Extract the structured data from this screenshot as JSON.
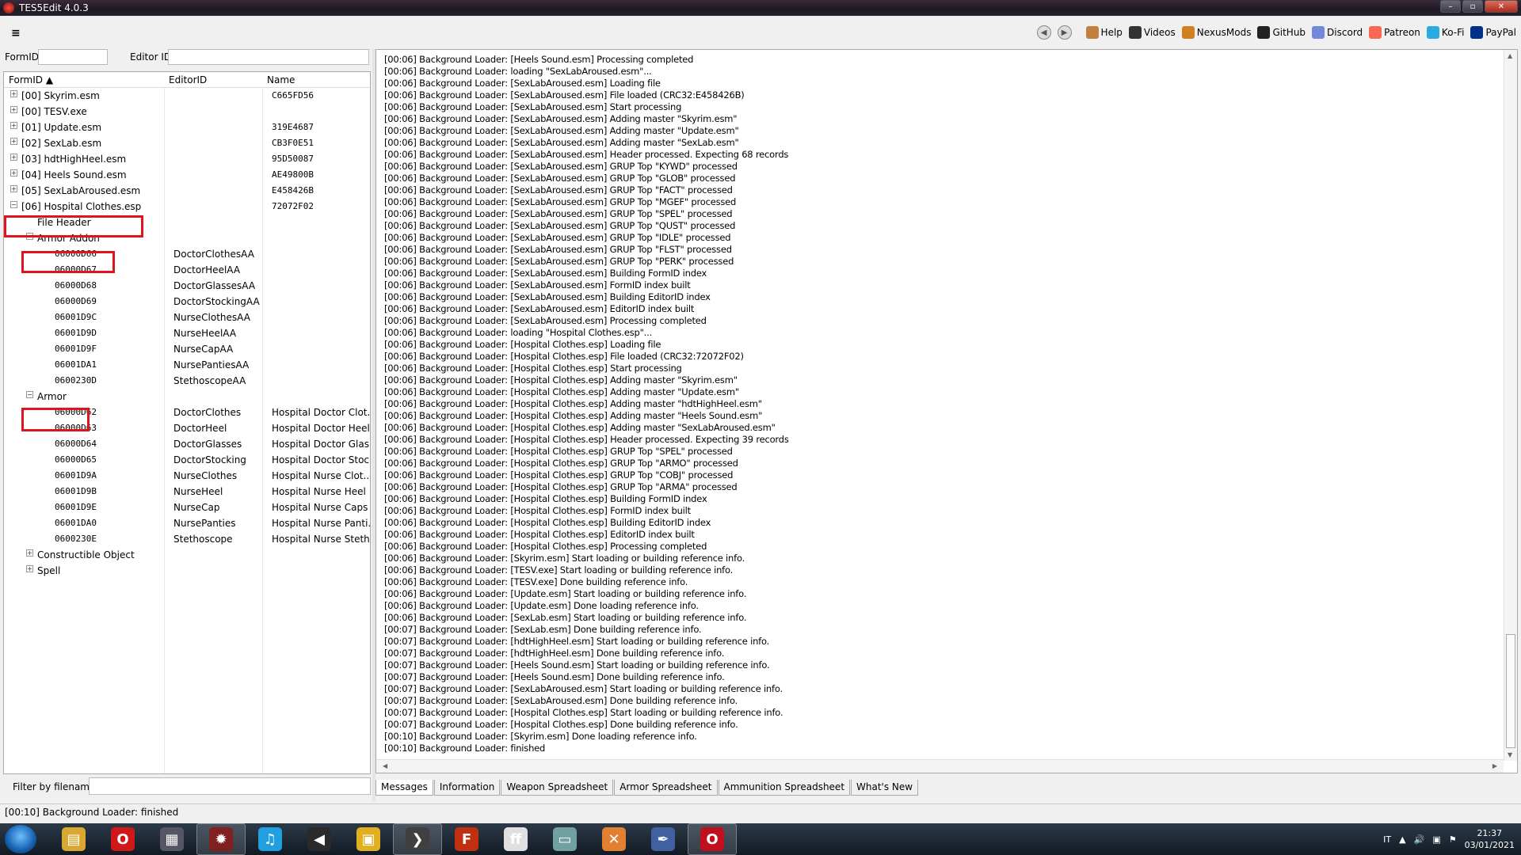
{
  "window": {
    "title": "TES5Edit 4.0.3"
  },
  "toolbar": {
    "links": [
      {
        "label": "Help",
        "icon": "book-icon",
        "color": "#c08040"
      },
      {
        "label": "Videos",
        "icon": "videos-icon",
        "color": "#333333"
      },
      {
        "label": "NexusMods",
        "icon": "nexusmods-icon",
        "color": "#d08020"
      },
      {
        "label": "GitHub",
        "icon": "github-icon",
        "color": "#222222"
      },
      {
        "label": "Discord",
        "icon": "discord-icon",
        "color": "#7289da"
      },
      {
        "label": "Patreon",
        "icon": "patreon-icon",
        "color": "#f96854"
      },
      {
        "label": "Ko-Fi",
        "icon": "kofi-icon",
        "color": "#29abe0"
      },
      {
        "label": "PayPal",
        "icon": "paypal-icon",
        "color": "#003087"
      }
    ]
  },
  "search": {
    "formid_label": "FormID",
    "editorid_label": "Editor ID"
  },
  "tree": {
    "columns": [
      "FormID",
      "EditorID",
      "Name"
    ],
    "rows": [
      {
        "indent": 0,
        "exp": "+",
        "formid": "[00] Skyrim.esm",
        "editorid": "",
        "name": "C665FD56",
        "mono": false
      },
      {
        "indent": 0,
        "exp": "+",
        "formid": "[00] TESV.exe",
        "editorid": "",
        "name": "",
        "mono": false
      },
      {
        "indent": 0,
        "exp": "+",
        "formid": "[01] Update.esm",
        "editorid": "",
        "name": "319E4687",
        "mono": false
      },
      {
        "indent": 0,
        "exp": "+",
        "formid": "[02] SexLab.esm",
        "editorid": "",
        "name": "CB3F0E51",
        "mono": false
      },
      {
        "indent": 0,
        "exp": "+",
        "formid": "[03] hdtHighHeel.esm",
        "editorid": "",
        "name": "95D50087",
        "mono": false
      },
      {
        "indent": 0,
        "exp": "+",
        "formid": "[04] Heels Sound.esm",
        "editorid": "",
        "name": "AE49800B",
        "mono": false
      },
      {
        "indent": 0,
        "exp": "+",
        "formid": "[05] SexLabAroused.esm",
        "editorid": "",
        "name": "E458426B",
        "mono": false
      },
      {
        "indent": 0,
        "exp": "-",
        "formid": "[06] Hospital Clothes.esp",
        "editorid": "",
        "name": "72072F02",
        "mono": false
      },
      {
        "indent": 1,
        "exp": "",
        "formid": "File Header",
        "editorid": "",
        "name": "",
        "mono": false
      },
      {
        "indent": 1,
        "exp": "-",
        "formid": "Armor Addon",
        "editorid": "",
        "name": "",
        "mono": false
      },
      {
        "indent": 2,
        "exp": "",
        "formid": "06000D66",
        "editorid": "DoctorClothesAA",
        "name": "",
        "mono": true
      },
      {
        "indent": 2,
        "exp": "",
        "formid": "06000D67",
        "editorid": "DoctorHeelAA",
        "name": "",
        "mono": true
      },
      {
        "indent": 2,
        "exp": "",
        "formid": "06000D68",
        "editorid": "DoctorGlassesAA",
        "name": "",
        "mono": true
      },
      {
        "indent": 2,
        "exp": "",
        "formid": "06000D69",
        "editorid": "DoctorStockingAA",
        "name": "",
        "mono": true
      },
      {
        "indent": 2,
        "exp": "",
        "formid": "06001D9C",
        "editorid": "NurseClothesAA",
        "name": "",
        "mono": true
      },
      {
        "indent": 2,
        "exp": "",
        "formid": "06001D9D",
        "editorid": "NurseHeelAA",
        "name": "",
        "mono": true
      },
      {
        "indent": 2,
        "exp": "",
        "formid": "06001D9F",
        "editorid": "NurseCapAA",
        "name": "",
        "mono": true
      },
      {
        "indent": 2,
        "exp": "",
        "formid": "06001DA1",
        "editorid": "NursePantiesAA",
        "name": "",
        "mono": true
      },
      {
        "indent": 2,
        "exp": "",
        "formid": "0600230D",
        "editorid": "StethoscopeAA",
        "name": "",
        "mono": true
      },
      {
        "indent": 1,
        "exp": "-",
        "formid": "Armor",
        "editorid": "",
        "name": "",
        "mono": false
      },
      {
        "indent": 2,
        "exp": "",
        "formid": "06000D62",
        "editorid": "DoctorClothes",
        "name": "Hospital Doctor Clot...",
        "mono": true
      },
      {
        "indent": 2,
        "exp": "",
        "formid": "06000D63",
        "editorid": "DoctorHeel",
        "name": "Hospital Doctor Heel",
        "mono": true
      },
      {
        "indent": 2,
        "exp": "",
        "formid": "06000D64",
        "editorid": "DoctorGlasses",
        "name": "Hospital Doctor Glas...",
        "mono": true
      },
      {
        "indent": 2,
        "exp": "",
        "formid": "06000D65",
        "editorid": "DoctorStocking",
        "name": "Hospital Doctor Stoc...",
        "mono": true
      },
      {
        "indent": 2,
        "exp": "",
        "formid": "06001D9A",
        "editorid": "NurseClothes",
        "name": "Hospital Nurse Clot...",
        "mono": true
      },
      {
        "indent": 2,
        "exp": "",
        "formid": "06001D9B",
        "editorid": "NurseHeel",
        "name": "Hospital Nurse Heel",
        "mono": true
      },
      {
        "indent": 2,
        "exp": "",
        "formid": "06001D9E",
        "editorid": "NurseCap",
        "name": "Hospital Nurse Caps",
        "mono": true
      },
      {
        "indent": 2,
        "exp": "",
        "formid": "06001DA0",
        "editorid": "NursePanties",
        "name": "Hospital Nurse Panti...",
        "mono": true
      },
      {
        "indent": 2,
        "exp": "",
        "formid": "0600230E",
        "editorid": "Stethoscope",
        "name": "Hospital Nurse Steth...",
        "mono": true
      },
      {
        "indent": 1,
        "exp": "+",
        "formid": "Constructible Object",
        "editorid": "",
        "name": "",
        "mono": false
      },
      {
        "indent": 1,
        "exp": "+",
        "formid": "Spell",
        "editorid": "",
        "name": "",
        "mono": false
      }
    ]
  },
  "filter": {
    "label": "Filter by filename:"
  },
  "messages": [
    "[00:06] Background Loader: [Heels Sound.esm] Processing completed",
    "[00:06] Background Loader: loading \"SexLabAroused.esm\"...",
    "[00:06] Background Loader: [SexLabAroused.esm] Loading file",
    "[00:06] Background Loader: [SexLabAroused.esm] File loaded (CRC32:E458426B)",
    "[00:06] Background Loader: [SexLabAroused.esm] Start processing",
    "[00:06] Background Loader: [SexLabAroused.esm] Adding master \"Skyrim.esm\"",
    "[00:06] Background Loader: [SexLabAroused.esm] Adding master \"Update.esm\"",
    "[00:06] Background Loader: [SexLabAroused.esm] Adding master \"SexLab.esm\"",
    "[00:06] Background Loader: [SexLabAroused.esm] Header processed. Expecting 68 records",
    "[00:06] Background Loader: [SexLabAroused.esm] GRUP Top \"KYWD\" processed",
    "[00:06] Background Loader: [SexLabAroused.esm] GRUP Top \"GLOB\" processed",
    "[00:06] Background Loader: [SexLabAroused.esm] GRUP Top \"FACT\" processed",
    "[00:06] Background Loader: [SexLabAroused.esm] GRUP Top \"MGEF\" processed",
    "[00:06] Background Loader: [SexLabAroused.esm] GRUP Top \"SPEL\" processed",
    "[00:06] Background Loader: [SexLabAroused.esm] GRUP Top \"QUST\" processed",
    "[00:06] Background Loader: [SexLabAroused.esm] GRUP Top \"IDLE\" processed",
    "[00:06] Background Loader: [SexLabAroused.esm] GRUP Top \"FLST\" processed",
    "[00:06] Background Loader: [SexLabAroused.esm] GRUP Top \"PERK\" processed",
    "[00:06] Background Loader: [SexLabAroused.esm] Building FormID index",
    "[00:06] Background Loader: [SexLabAroused.esm] FormID index built",
    "[00:06] Background Loader: [SexLabAroused.esm] Building EditorID index",
    "[00:06] Background Loader: [SexLabAroused.esm] EditorID index built",
    "[00:06] Background Loader: [SexLabAroused.esm] Processing completed",
    "[00:06] Background Loader: loading \"Hospital Clothes.esp\"...",
    "[00:06] Background Loader: [Hospital Clothes.esp] Loading file",
    "[00:06] Background Loader: [Hospital Clothes.esp] File loaded (CRC32:72072F02)",
    "[00:06] Background Loader: [Hospital Clothes.esp] Start processing",
    "[00:06] Background Loader: [Hospital Clothes.esp] Adding master \"Skyrim.esm\"",
    "[00:06] Background Loader: [Hospital Clothes.esp] Adding master \"Update.esm\"",
    "[00:06] Background Loader: [Hospital Clothes.esp] Adding master \"hdtHighHeel.esm\"",
    "[00:06] Background Loader: [Hospital Clothes.esp] Adding master \"Heels Sound.esm\"",
    "[00:06] Background Loader: [Hospital Clothes.esp] Adding master \"SexLabAroused.esm\"",
    "[00:06] Background Loader: [Hospital Clothes.esp] Header processed. Expecting 39 records",
    "[00:06] Background Loader: [Hospital Clothes.esp] GRUP Top \"SPEL\" processed",
    "[00:06] Background Loader: [Hospital Clothes.esp] GRUP Top \"ARMO\" processed",
    "[00:06] Background Loader: [Hospital Clothes.esp] GRUP Top \"COBJ\" processed",
    "[00:06] Background Loader: [Hospital Clothes.esp] GRUP Top \"ARMA\" processed",
    "[00:06] Background Loader: [Hospital Clothes.esp] Building FormID index",
    "[00:06] Background Loader: [Hospital Clothes.esp] FormID index built",
    "[00:06] Background Loader: [Hospital Clothes.esp] Building EditorID index",
    "[00:06] Background Loader: [Hospital Clothes.esp] EditorID index built",
    "[00:06] Background Loader: [Hospital Clothes.esp] Processing completed",
    "[00:06] Background Loader: [Skyrim.esm] Start loading or building reference info.",
    "[00:06] Background Loader: [TESV.exe] Start loading or building reference info.",
    "[00:06] Background Loader: [TESV.exe] Done building reference info.",
    "[00:06] Background Loader: [Update.esm] Start loading or building reference info.",
    "[00:06] Background Loader: [Update.esm] Done loading reference info.",
    "[00:06] Background Loader: [SexLab.esm] Start loading or building reference info.",
    "[00:07] Background Loader: [SexLab.esm] Done building reference info.",
    "[00:07] Background Loader: [hdtHighHeel.esm] Start loading or building reference info.",
    "[00:07] Background Loader: [hdtHighHeel.esm] Done building reference info.",
    "[00:07] Background Loader: [Heels Sound.esm] Start loading or building reference info.",
    "[00:07] Background Loader: [Heels Sound.esm] Done building reference info.",
    "[00:07] Background Loader: [SexLabAroused.esm] Start loading or building reference info.",
    "[00:07] Background Loader: [SexLabAroused.esm] Done building reference info.",
    "[00:07] Background Loader: [Hospital Clothes.esp] Start loading or building reference info.",
    "[00:07] Background Loader: [Hospital Clothes.esp] Done building reference info.",
    "[00:10] Background Loader: [Skyrim.esm] Done loading reference info.",
    "[00:10] Background Loader: finished"
  ],
  "tabs": [
    "Messages",
    "Information",
    "Weapon Spreadsheet",
    "Armor Spreadsheet",
    "Ammunition Spreadsheet",
    "What's New"
  ],
  "status": {
    "text": "[00:10] Background Loader: finished"
  },
  "taskbar": {
    "apps": [
      {
        "name": "explorer-icon",
        "color": "#d8a830",
        "glyph": "▤"
      },
      {
        "name": "opera-icon",
        "color": "#d01818",
        "glyph": "O"
      },
      {
        "name": "media-icon",
        "color": "#555566",
        "glyph": "▦"
      },
      {
        "name": "tes5edit-icon",
        "color": "#802020",
        "glyph": "✹"
      },
      {
        "name": "music-icon",
        "color": "#20a0e0",
        "glyph": "♫"
      },
      {
        "name": "audio-editor-icon",
        "color": "#2a2a2a",
        "glyph": "◀"
      },
      {
        "name": "notes-icon",
        "color": "#e0b020",
        "glyph": "▣"
      },
      {
        "name": "terminal-icon",
        "color": "#404040",
        "glyph": "❯"
      },
      {
        "name": "filezilla-icon",
        "color": "#c03010",
        "glyph": "F"
      },
      {
        "name": "ffdec-icon",
        "color": "#e0e0e0",
        "glyph": "ff"
      },
      {
        "name": "window-icon",
        "color": "#70a0a0",
        "glyph": "▭"
      },
      {
        "name": "app-x-icon",
        "color": "#e08030",
        "glyph": "✕"
      },
      {
        "name": "pen-icon",
        "color": "#4060a0",
        "glyph": "✒"
      },
      {
        "name": "opera-gx-icon",
        "color": "#c01020",
        "glyph": "O"
      }
    ],
    "lang": "IT",
    "time": "21:37",
    "date": "03/01/2021"
  }
}
